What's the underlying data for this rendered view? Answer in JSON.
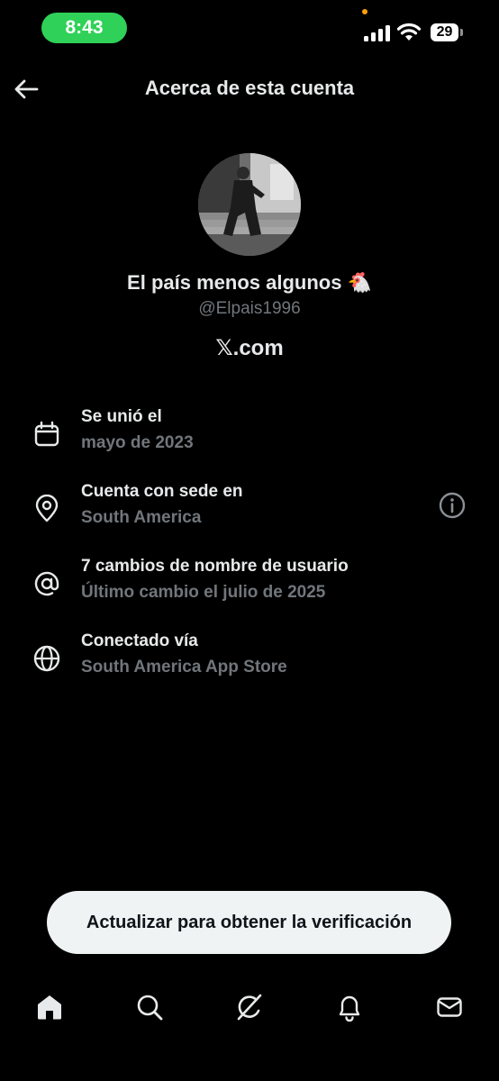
{
  "status_bar": {
    "time": "8:43",
    "battery_level": "29",
    "time_pill_color": "#30d158"
  },
  "header": {
    "back_icon": "arrow-left-icon",
    "title": "Acerca de esta cuenta"
  },
  "profile": {
    "display_name": "El país menos algunos 🐔",
    "handle": "@Elpais1996",
    "site": "𝕏.com"
  },
  "info_rows": [
    {
      "icon": "calendar-icon",
      "title": "Se unió el",
      "subtitle": "mayo de 2023"
    },
    {
      "icon": "location-pin-icon",
      "title": "Cuenta con sede en",
      "subtitle": "South America",
      "action_icon": "info-icon"
    },
    {
      "icon": "at-sign-icon",
      "title": "7 cambios de nombre de usuario",
      "subtitle": "Último cambio el julio de 2025"
    },
    {
      "icon": "globe-icon",
      "title": "Conectado vía",
      "subtitle": "South America App Store"
    }
  ],
  "cta": {
    "label": "Actualizar para obtener la verificación"
  },
  "bottom_nav": {
    "items": [
      "home-icon",
      "search-icon",
      "grok-icon",
      "bell-icon",
      "mail-icon"
    ],
    "active": "home-icon"
  },
  "colors": {
    "background": "#000000",
    "primary_text": "#e7e9ea",
    "secondary_text": "#71767b",
    "cta_background": "#eff3f4"
  }
}
